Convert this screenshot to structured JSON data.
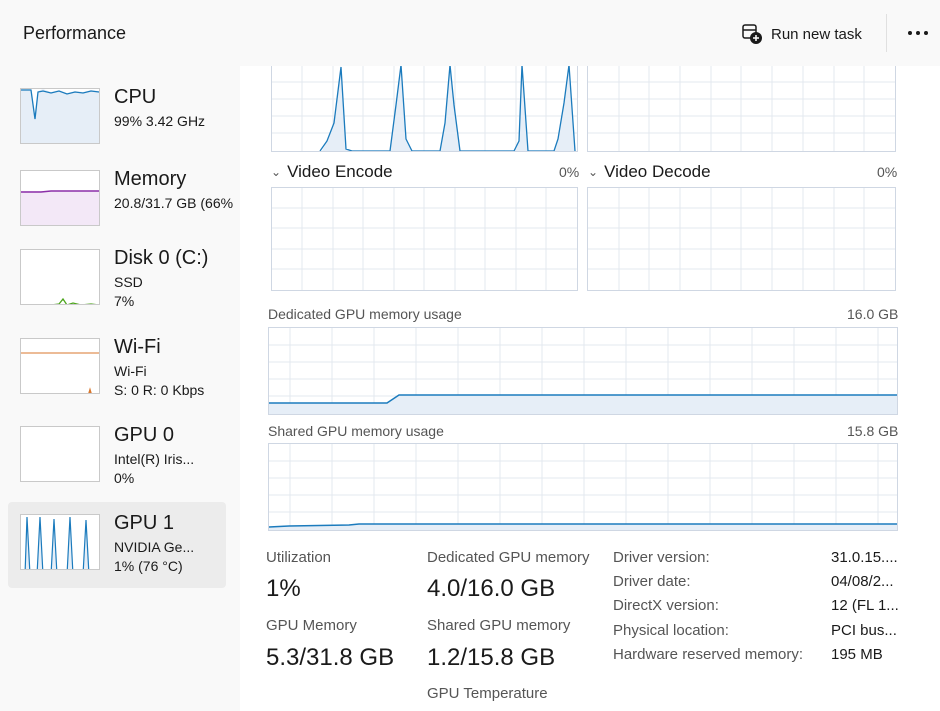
{
  "header": {
    "title": "Performance",
    "run_new_task": "Run new task",
    "more": "…"
  },
  "sidebar": {
    "items": [
      {
        "name": "CPU",
        "line1": "99%  3.42 GHz",
        "line2": ""
      },
      {
        "name": "Memory",
        "line1": "20.8/31.7 GB (66%",
        "line2": ""
      },
      {
        "name": "Disk 0 (C:)",
        "line1": "SSD",
        "line2": "7%"
      },
      {
        "name": "Wi-Fi",
        "line1": "Wi-Fi",
        "line2": "S: 0  R: 0 Kbps"
      },
      {
        "name": "GPU 0",
        "line1": "Intel(R) Iris...",
        "line2": "0%"
      },
      {
        "name": "GPU 1",
        "line1": "NVIDIA Ge...",
        "line2": "1%  (76 °C)"
      }
    ],
    "selected_index": 5
  },
  "engines": {
    "video_encode": {
      "label": "Video Encode",
      "percent": "0%"
    },
    "video_decode": {
      "label": "Video Decode",
      "percent": "0%"
    }
  },
  "dedicated_memory_graph": {
    "label": "Dedicated GPU memory usage",
    "max": "16.0 GB"
  },
  "shared_memory_graph": {
    "label": "Shared GPU memory usage",
    "max": "15.8 GB"
  },
  "stats": {
    "utilization": {
      "label": "Utilization",
      "value": "1%"
    },
    "dedicated_memory": {
      "label": "Dedicated GPU memory",
      "value": "4.0/16.0 GB"
    },
    "gpu_memory": {
      "label": "GPU Memory",
      "value": "5.3/31.8 GB"
    },
    "shared_memory": {
      "label": "Shared GPU memory",
      "value": "1.2/15.8 GB"
    },
    "gpu_temperature": {
      "label": "GPU Temperature"
    }
  },
  "details": {
    "driver_version": {
      "key": "Driver version:",
      "value": "31.0.15...."
    },
    "driver_date": {
      "key": "Driver date:",
      "value": "04/08/2..."
    },
    "directx_version": {
      "key": "DirectX version:",
      "value": "12 (FL 1..."
    },
    "physical_location": {
      "key": "Physical location:",
      "value": "PCI bus..."
    },
    "hw_reserved_memory": {
      "key": "Hardware reserved memory:",
      "value": "195 MB"
    }
  },
  "colors": {
    "gpu_line": "#1b7bbd",
    "gpu_fill": "#e6eef7",
    "memory_line": "#8b2fa8",
    "disk_line": "#4ca51c",
    "wifi_line": "#d9772d",
    "grid": "#e3e8ef"
  },
  "icons": {
    "run_task": "run-task-icon",
    "more": "more-icon",
    "chevron": "chevron-down-icon"
  }
}
